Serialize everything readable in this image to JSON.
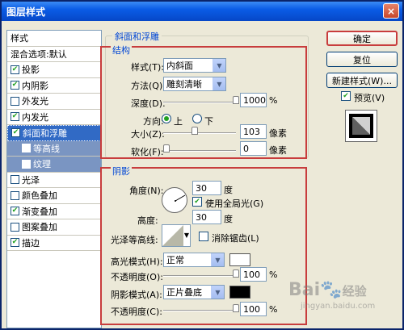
{
  "window": {
    "title": "图层样式",
    "close": "×"
  },
  "left_list": {
    "header": "样式",
    "blend": "混合选项:默认",
    "items": [
      {
        "label": "投影",
        "checked": true
      },
      {
        "label": "内阴影",
        "checked": true
      },
      {
        "label": "外发光",
        "checked": false
      },
      {
        "label": "内发光",
        "checked": true
      },
      {
        "label": "斜面和浮雕",
        "checked": true,
        "selected": true
      },
      {
        "label": "等高线",
        "checked": false,
        "sub": true
      },
      {
        "label": "纹理",
        "checked": false,
        "sub": true
      },
      {
        "label": "光泽",
        "checked": false
      },
      {
        "label": "颜色叠加",
        "checked": false
      },
      {
        "label": "渐变叠加",
        "checked": true
      },
      {
        "label": "图案叠加",
        "checked": false
      },
      {
        "label": "描边",
        "checked": true
      }
    ]
  },
  "bevel": {
    "group_title": "斜面和浮雕",
    "structure_title": "结构",
    "style_label": "样式(T):",
    "style_value": "内斜面",
    "technique_label": "方法(Q):",
    "technique_value": "雕刻清晰",
    "depth_label": "深度(D):",
    "depth_value": "1000",
    "depth_unit": "%",
    "depth_level": 1.0,
    "direction_label": "方向:",
    "dir_up": "上",
    "dir_down": "下",
    "size_label": "大小(Z):",
    "size_value": "103",
    "size_unit": "像素",
    "size_level": 0.41,
    "soften_label": "软化(F):",
    "soften_value": "0",
    "soften_unit": "像素",
    "soften_level": 0.0
  },
  "shading": {
    "title": "阴影",
    "angle_label": "角度(N):",
    "angle_value": "30",
    "angle_unit": "度",
    "global_light": "使用全局光(G)",
    "altitude_label": "高度:",
    "altitude_value": "30",
    "altitude_unit": "度",
    "gloss_label": "光泽等高线:",
    "anti_alias": "消除锯齿(L)",
    "highlight_label": "高光模式(H):",
    "highlight_value": "正常",
    "opacity1_label": "不透明度(O):",
    "opacity1_value": "100",
    "opacity1_unit": "%",
    "shadow_label": "阴影模式(A):",
    "shadow_value": "正片叠底",
    "opacity2_label": "不透明度(C):",
    "opacity2_value": "100",
    "opacity2_unit": "%"
  },
  "buttons": {
    "ok": "确定",
    "reset": "复位",
    "new_style": "新建样式(W)...",
    "preview": "预览(V)"
  },
  "colors": {
    "highlight_color": "#ffffff",
    "shadow_color": "#000000"
  },
  "watermark": {
    "brand": "Bai",
    "brand_suffix": "经验",
    "url": "jingyan.baidu.com"
  }
}
